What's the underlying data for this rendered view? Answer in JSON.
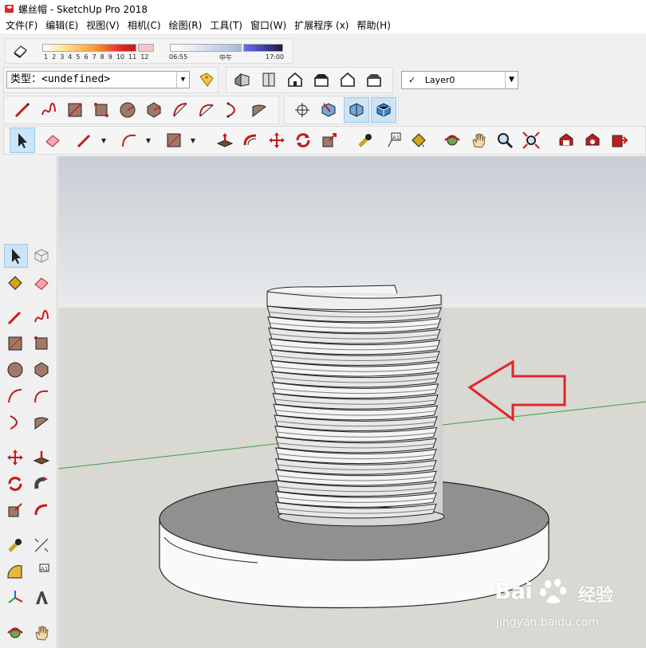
{
  "window": {
    "title": "螺丝帽 - SketchUp Pro 2018"
  },
  "menu": [
    "文件(F)",
    "编辑(E)",
    "视图(V)",
    "相机(C)",
    "绘图(R)",
    "工具(T)",
    "窗口(W)",
    "扩展程序 (x)",
    "帮助(H)"
  ],
  "shadows": {
    "month_ticks": [
      "1",
      "2",
      "3",
      "4",
      "5",
      "6",
      "7",
      "8",
      "9",
      "10",
      "11",
      "12"
    ],
    "time_start": "06:55",
    "time_mid": "中午",
    "time_end": "17:00"
  },
  "component_type": {
    "label": "类型：",
    "value": "<undefined>"
  },
  "layer": {
    "check": "✓",
    "name": "Layer0"
  },
  "viewport_colors": {
    "sky_top": "#c9ced5",
    "sky_bottom": "#e8eaec",
    "ground": "#d9d8d3",
    "model_face": "#f2f2f2",
    "model_dark": "#8f8f8f",
    "arrow": "#e0262a"
  },
  "watermark": {
    "brand": "Bai",
    "brand_suffix": "经验",
    "url": "jingyan.baidu.com"
  }
}
